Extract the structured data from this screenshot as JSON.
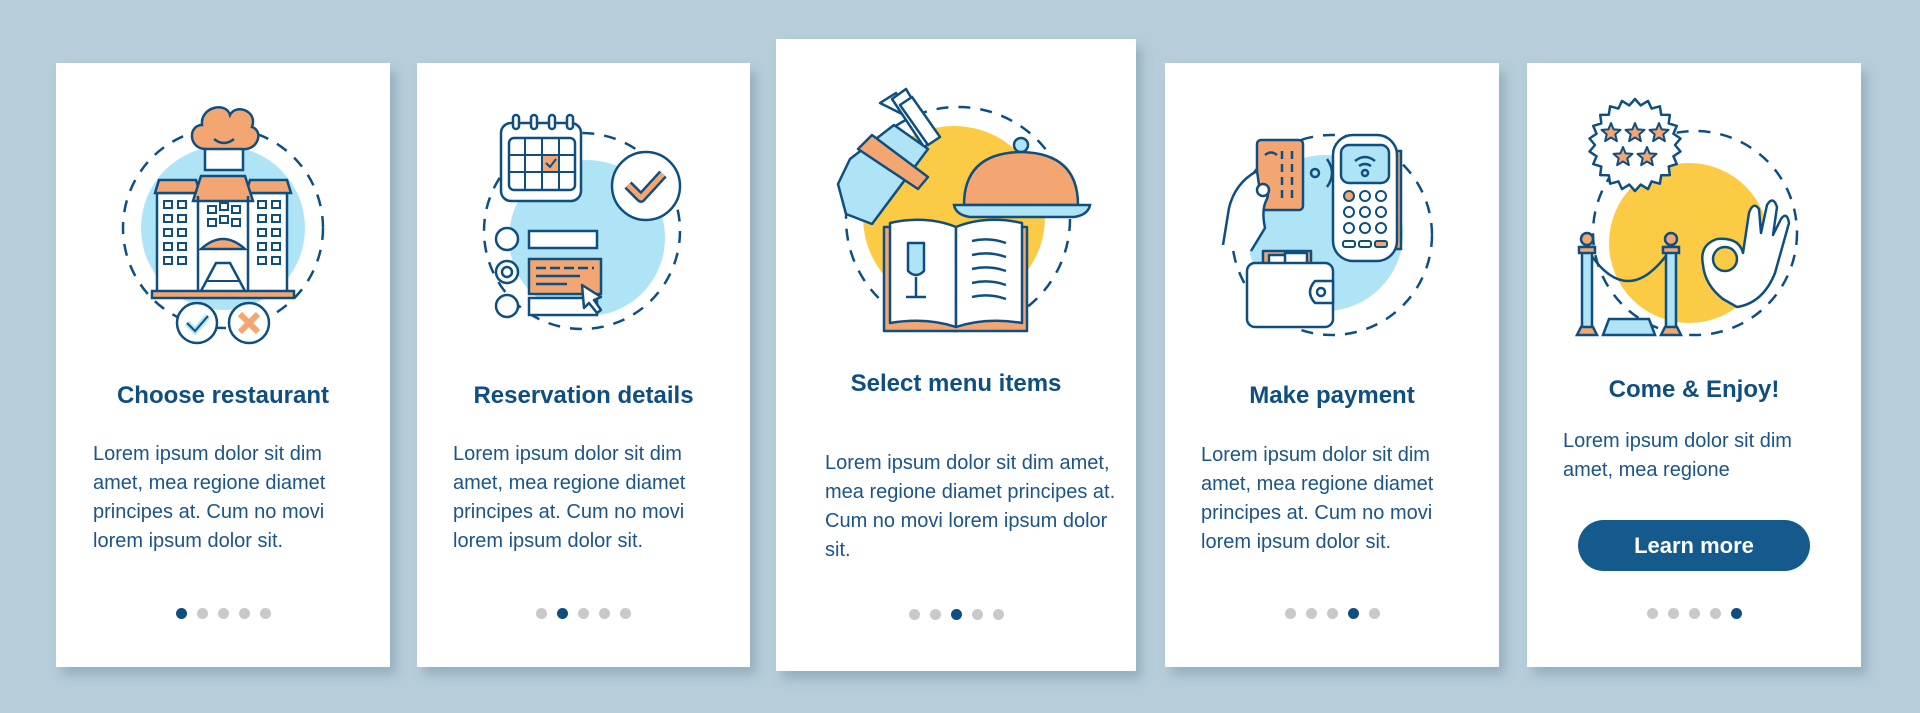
{
  "colors": {
    "background": "#b6ceda",
    "card": "#ffffff",
    "primary": "#0f4f80",
    "body_text": "#1a5585",
    "accent_orange": "#f4a672",
    "accent_blue": "#aee4f6",
    "accent_yellow": "#fbcb46",
    "dot_inactive": "#c9c9c9"
  },
  "cards": [
    {
      "illustration": "restaurant-building-icon",
      "title": "Choose restaurant",
      "body": "Lorem ipsum dolor sit dim amet, mea regione diamet principes at. Cum no movi lorem ipsum dolor sit.",
      "active_dot": 1
    },
    {
      "illustration": "reservation-form-icon",
      "title": "Reservation details",
      "body": "Lorem ipsum dolor sit dim amet, mea regione diamet principes at. Cum no movi lorem ipsum dolor sit.",
      "active_dot": 2
    },
    {
      "illustration": "menu-items-icon",
      "title": "Select menu items",
      "body": "Lorem ipsum dolor sit dim amet, mea regione diamet principes at. Cum no movi lorem ipsum dolor sit.",
      "active_dot": 3
    },
    {
      "illustration": "payment-terminal-icon",
      "title": "Make payment",
      "body": "Lorem ipsum dolor sit dim amet, mea regione diamet principes at. Cum no movi lorem ipsum dolor sit.",
      "active_dot": 4
    },
    {
      "illustration": "enjoy-rating-icon",
      "title": "Come & Enjoy!",
      "body": "Lorem ipsum dolor sit dim amet, mea regione",
      "button_label": "Learn more",
      "active_dot": 5
    }
  ],
  "pagination": {
    "total": 5
  }
}
